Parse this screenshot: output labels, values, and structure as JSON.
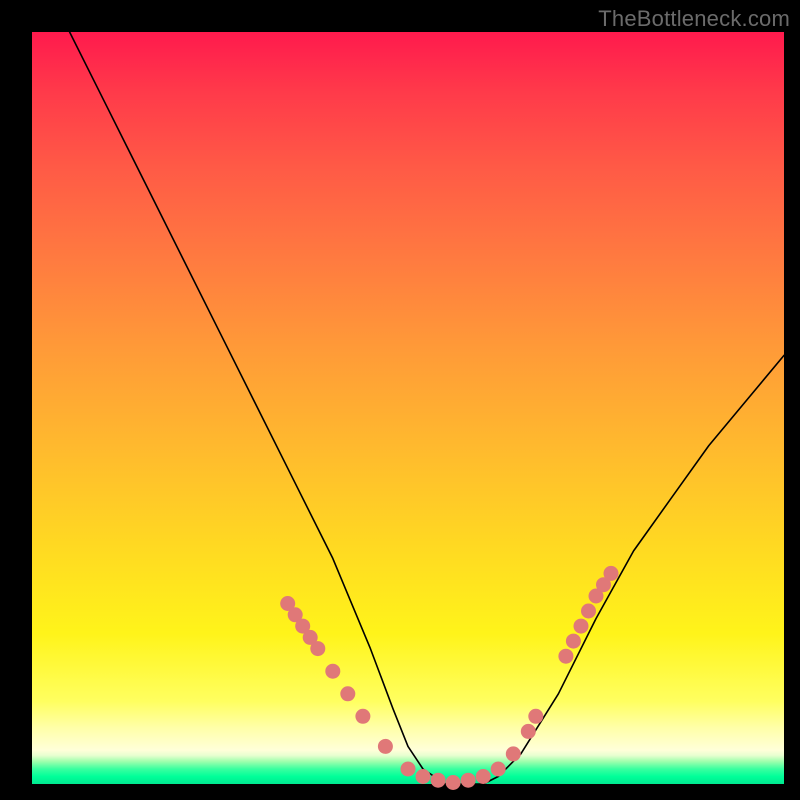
{
  "watermark": "TheBottleneck.com",
  "chart_data": {
    "type": "line",
    "title": "",
    "xlabel": "",
    "ylabel": "",
    "xlim": [
      0,
      100
    ],
    "ylim": [
      0,
      100
    ],
    "grid": false,
    "legend": false,
    "series": [
      {
        "name": "curve",
        "x": [
          5,
          10,
          15,
          20,
          25,
          30,
          35,
          40,
          45,
          48,
          50,
          52,
          55,
          58,
          60,
          62,
          65,
          70,
          75,
          80,
          85,
          90,
          95,
          100
        ],
        "y": [
          100,
          90,
          80,
          70,
          60,
          50,
          40,
          30,
          18,
          10,
          5,
          2,
          0,
          0,
          0,
          1,
          4,
          12,
          22,
          31,
          38,
          45,
          51,
          57
        ]
      }
    ],
    "marker_points": {
      "name": "salmon-dots",
      "x": [
        34,
        35,
        36,
        37,
        38,
        40,
        42,
        44,
        47,
        50,
        52,
        54,
        56,
        58,
        60,
        62,
        64,
        66,
        67,
        71,
        72,
        73,
        74,
        75,
        76,
        77
      ],
      "y": [
        24,
        22.5,
        21,
        19.5,
        18,
        15,
        12,
        9,
        5,
        2,
        1,
        0.5,
        0.2,
        0.5,
        1,
        2,
        4,
        7,
        9,
        17,
        19,
        21,
        23,
        25,
        26.5,
        28
      ]
    },
    "background_gradient": {
      "stops": [
        {
          "pos": 0,
          "color": "#ff1a4d"
        },
        {
          "pos": 0.55,
          "color": "#ffb92e"
        },
        {
          "pos": 0.8,
          "color": "#fff41a"
        },
        {
          "pos": 0.95,
          "color": "#ffffd9"
        },
        {
          "pos": 1.0,
          "color": "#00e890"
        }
      ]
    }
  }
}
